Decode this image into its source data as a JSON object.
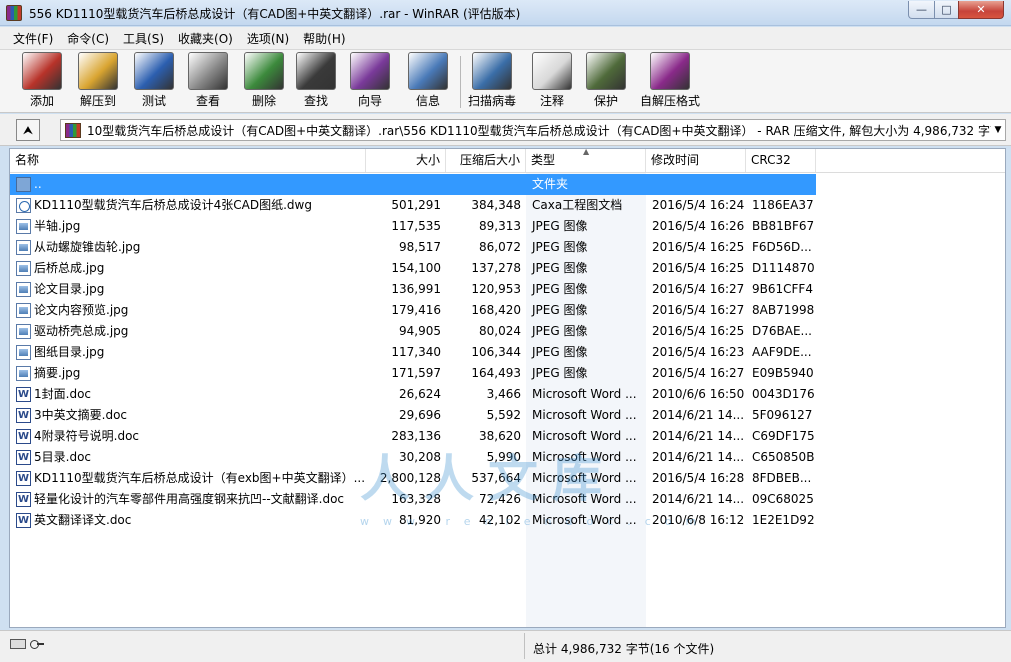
{
  "window": {
    "title": "556 KD1110型载货汽车后桥总成设计（有CAD图+中英文翻译）.rar - WinRAR (评估版本)",
    "min_glyph": "—",
    "max_glyph": "□",
    "close_glyph": "✕"
  },
  "menu": [
    "文件(F)",
    "命令(C)",
    "工具(S)",
    "收藏夹(O)",
    "选项(N)",
    "帮助(H)"
  ],
  "toolbar": [
    {
      "label": "添加",
      "icon": "add-books-icon",
      "color": "#b8332a"
    },
    {
      "label": "解压到",
      "icon": "extract-folder-icon",
      "color": "#d9a531"
    },
    {
      "label": "测试",
      "icon": "test-check-icon",
      "color": "#2c5fb0"
    },
    {
      "label": "查看",
      "icon": "view-glasses-icon",
      "color": "#8a8a8a"
    },
    {
      "label": "删除",
      "icon": "delete-recycle-icon",
      "color": "#3c8a3c"
    },
    {
      "label": "查找",
      "icon": "find-binoculars-icon",
      "color": "#3a3a3a"
    },
    {
      "label": "向导",
      "icon": "wizard-icon",
      "color": "#7a3a9a"
    },
    {
      "label": "信息",
      "icon": "info-icon",
      "color": "#4a7ab8"
    },
    {
      "label": "扫描病毒",
      "icon": "virus-scan-icon",
      "color": "#3b6ea8"
    },
    {
      "label": "注释",
      "icon": "comment-pen-icon",
      "color": "#d8d8d8"
    },
    {
      "label": "保护",
      "icon": "protect-shield-icon",
      "color": "#4f6a3a"
    },
    {
      "label": "自解压格式",
      "icon": "sfx-box-icon",
      "color": "#8a2a8a"
    }
  ],
  "address": {
    "up_glyph": "⮝",
    "path": "10型载货汽车后桥总成设计（有CAD图+中英文翻译）.rar\\556 KD1110型载货汽车后桥总成设计（有CAD图+中英文翻译） - RAR 压缩文件, 解包大小为 4,986,732 字节",
    "dropdown_glyph": "▼"
  },
  "columns": {
    "name": "名称",
    "size": "大小",
    "packed": "压缩后大小",
    "type": "类型",
    "modified": "修改时间",
    "crc": "CRC32",
    "sort_glyph": "▲"
  },
  "files": [
    {
      "name": "..",
      "size": "",
      "packed": "",
      "type": "文件夹",
      "modified": "",
      "crc": "",
      "icon": "folder",
      "selected": true
    },
    {
      "name": "KD1110型载货汽车后桥总成设计4张CAD图纸.dwg",
      "size": "501,291",
      "packed": "384,348",
      "type": "Caxa工程图文档",
      "modified": "2016/5/4 16:24",
      "crc": "1186EA37",
      "icon": "dwg"
    },
    {
      "name": "半轴.jpg",
      "size": "117,535",
      "packed": "89,313",
      "type": "JPEG 图像",
      "modified": "2016/5/4 16:26",
      "crc": "BB81BF67",
      "icon": "img"
    },
    {
      "name": "从动螺旋锥齿轮.jpg",
      "size": "98,517",
      "packed": "86,072",
      "type": "JPEG 图像",
      "modified": "2016/5/4 16:25",
      "crc": "F6D56D...",
      "icon": "img"
    },
    {
      "name": "后桥总成.jpg",
      "size": "154,100",
      "packed": "137,278",
      "type": "JPEG 图像",
      "modified": "2016/5/4 16:25",
      "crc": "D1114870",
      "icon": "img"
    },
    {
      "name": "论文目录.jpg",
      "size": "136,991",
      "packed": "120,953",
      "type": "JPEG 图像",
      "modified": "2016/5/4 16:27",
      "crc": "9B61CFF4",
      "icon": "img"
    },
    {
      "name": "论文内容预览.jpg",
      "size": "179,416",
      "packed": "168,420",
      "type": "JPEG 图像",
      "modified": "2016/5/4 16:27",
      "crc": "8AB71998",
      "icon": "img"
    },
    {
      "name": "驱动桥壳总成.jpg",
      "size": "94,905",
      "packed": "80,024",
      "type": "JPEG 图像",
      "modified": "2016/5/4 16:25",
      "crc": "D76BAE...",
      "icon": "img"
    },
    {
      "name": "图纸目录.jpg",
      "size": "117,340",
      "packed": "106,344",
      "type": "JPEG 图像",
      "modified": "2016/5/4 16:23",
      "crc": "AAF9DE...",
      "icon": "img"
    },
    {
      "name": "摘要.jpg",
      "size": "171,597",
      "packed": "164,493",
      "type": "JPEG 图像",
      "modified": "2016/5/4 16:27",
      "crc": "E09B5940",
      "icon": "img"
    },
    {
      "name": "1封面.doc",
      "size": "26,624",
      "packed": "3,466",
      "type": "Microsoft Word ...",
      "modified": "2010/6/6 16:50",
      "crc": "0043D176",
      "icon": "doc"
    },
    {
      "name": "3中英文摘要.doc",
      "size": "29,696",
      "packed": "5,592",
      "type": "Microsoft Word ...",
      "modified": "2014/6/21 14...",
      "crc": "5F096127",
      "icon": "doc"
    },
    {
      "name": "4附录符号说明.doc",
      "size": "283,136",
      "packed": "38,620",
      "type": "Microsoft Word ...",
      "modified": "2014/6/21 14...",
      "crc": "C69DF175",
      "icon": "doc"
    },
    {
      "name": "5目录.doc",
      "size": "30,208",
      "packed": "5,990",
      "type": "Microsoft Word ...",
      "modified": "2014/6/21 14...",
      "crc": "C650850B",
      "icon": "doc"
    },
    {
      "name": "KD1110型载货汽车后桥总成设计（有exb图+中英文翻译）....",
      "size": "2,800,128",
      "packed": "537,664",
      "type": "Microsoft Word ...",
      "modified": "2016/5/4 16:28",
      "crc": "8FDBEB...",
      "icon": "doc"
    },
    {
      "name": "轻量化设计的汽车零部件用高强度钢来抗凹--文献翻译.doc",
      "size": "163,328",
      "packed": "72,426",
      "type": "Microsoft Word ...",
      "modified": "2014/6/21 14...",
      "crc": "09C68025",
      "icon": "doc"
    },
    {
      "name": "英文翻译译文.doc",
      "size": "81,920",
      "packed": "42,102",
      "type": "Microsoft Word ...",
      "modified": "2010/6/8 16:12",
      "crc": "1E2E1D92",
      "icon": "doc"
    }
  ],
  "watermark": {
    "main": "人人文库",
    "sub": "www.renrendoc.com"
  },
  "status": {
    "total": "总计 4,986,732 字节(16 个文件)"
  }
}
